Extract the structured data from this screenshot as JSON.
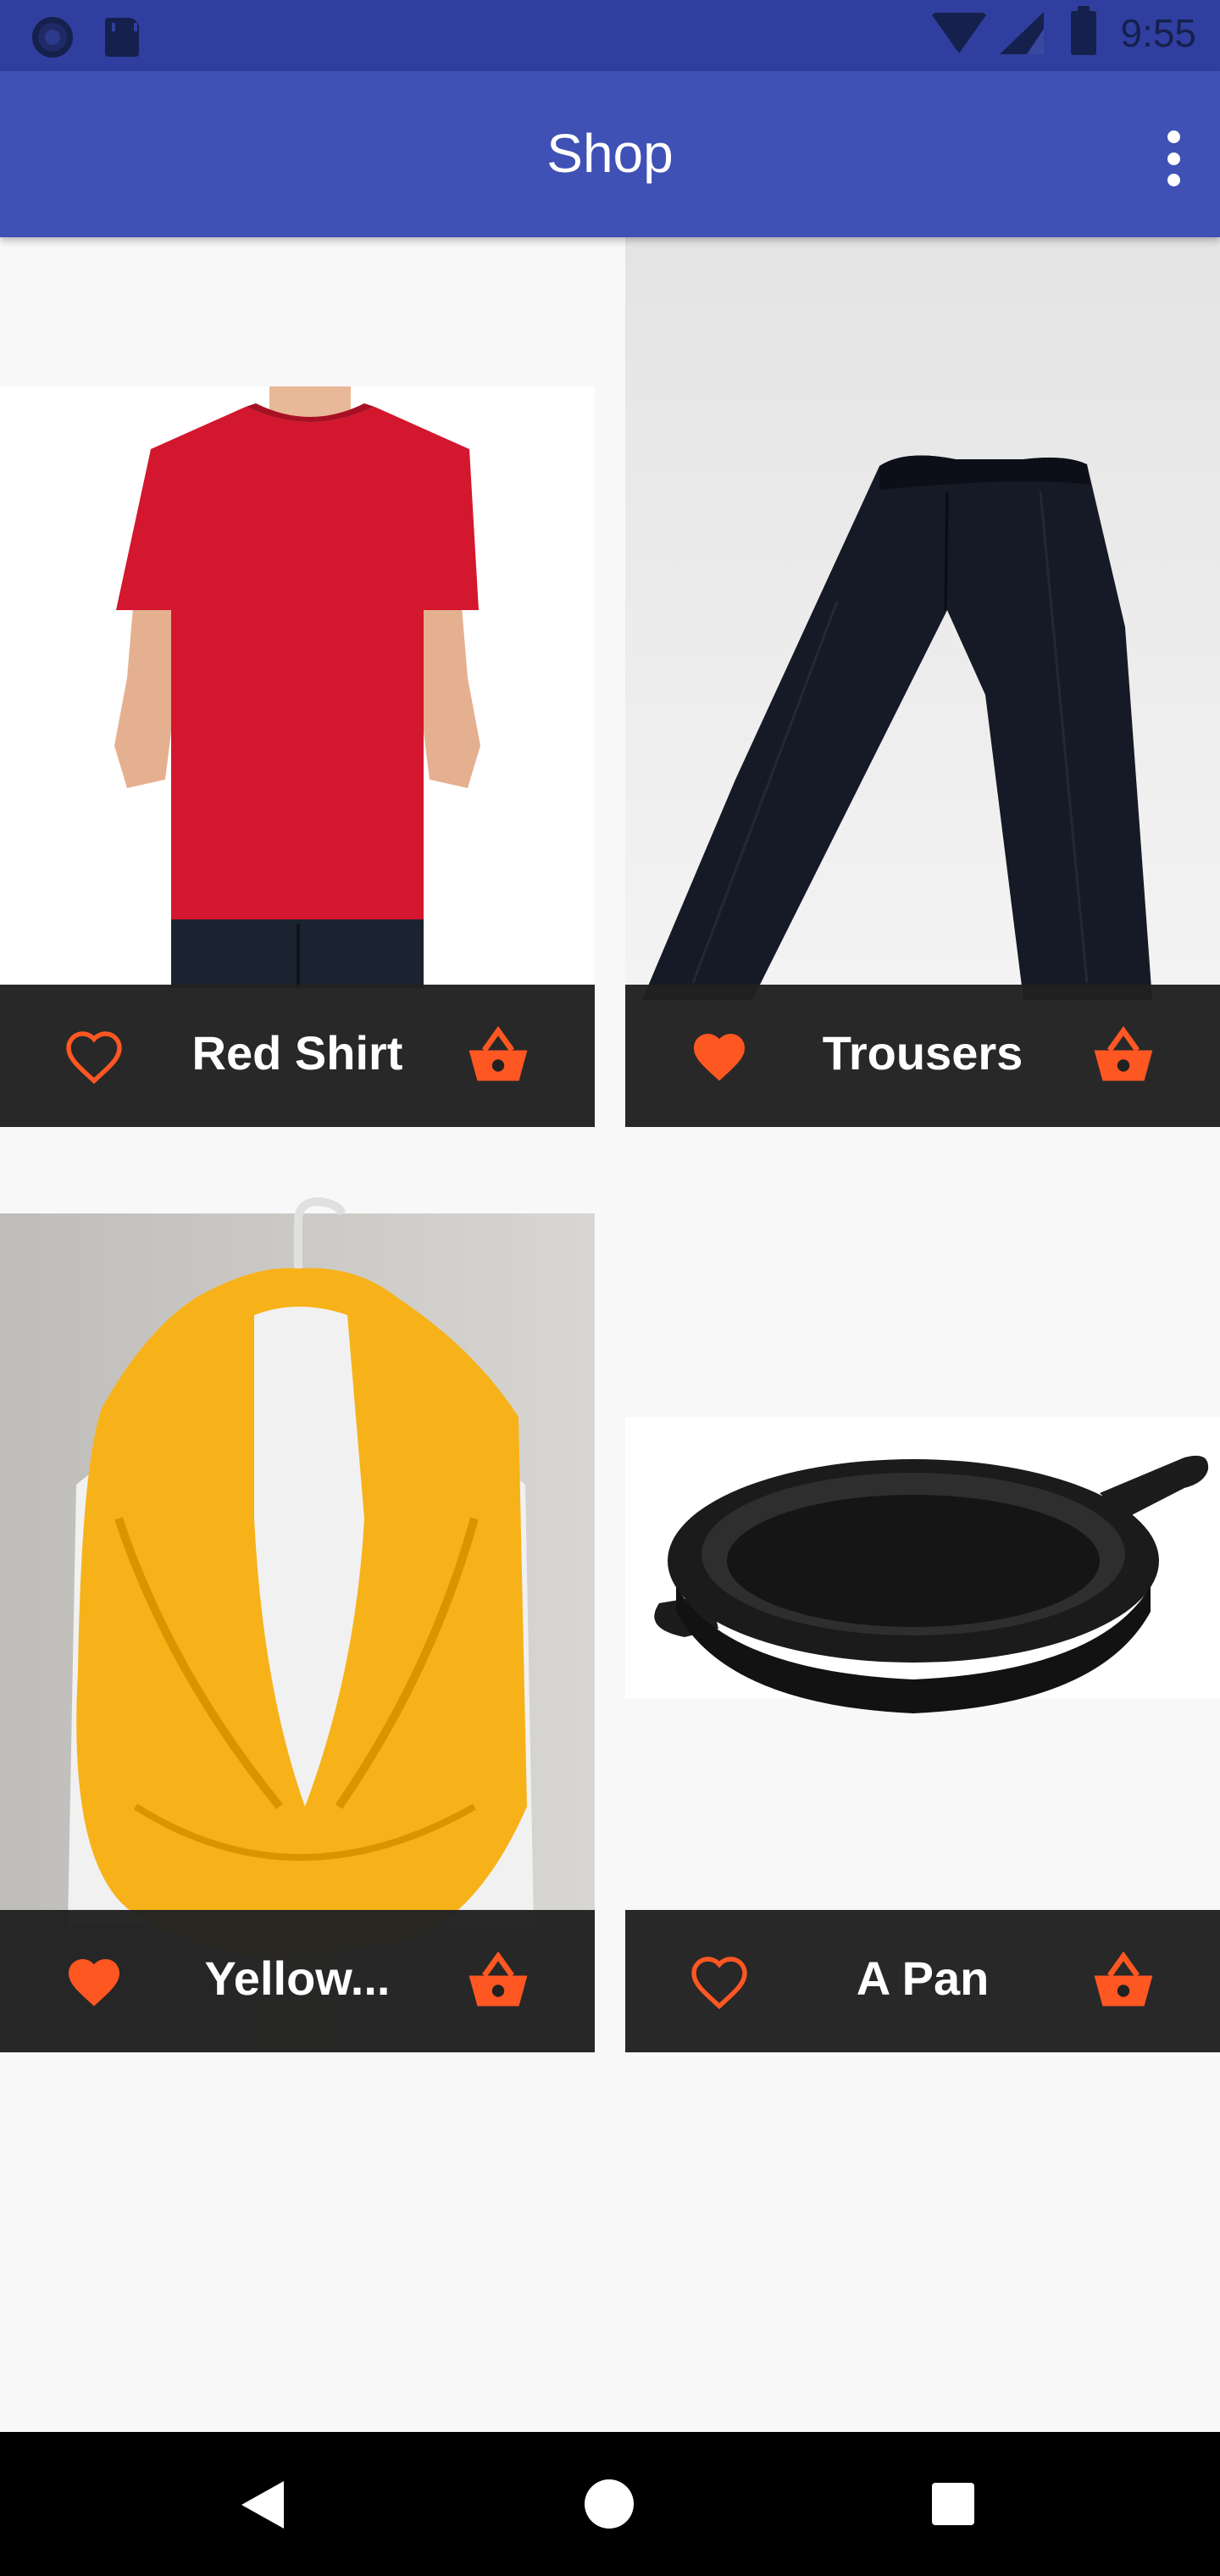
{
  "status_bar": {
    "time": "9:55",
    "icons": [
      "circle-app-icon",
      "sd-card-icon",
      "wifi-icon",
      "signal-icon",
      "battery-icon"
    ]
  },
  "app_bar": {
    "title": "Shop",
    "menu_icon": "overflow-menu-icon"
  },
  "products": [
    {
      "title": "Red Shirt",
      "favorited": false,
      "image": "red t-shirt on model",
      "fav_icon": "heart-outline-icon",
      "cart_icon": "shopping-basket-icon"
    },
    {
      "title": "Trousers",
      "favorited": true,
      "image": "black trousers",
      "fav_icon": "heart-filled-icon",
      "cart_icon": "shopping-basket-icon"
    },
    {
      "title": "Yellow...",
      "favorited": true,
      "image": "yellow knitted scarf on mannequin",
      "fav_icon": "heart-filled-icon",
      "cart_icon": "shopping-basket-icon"
    },
    {
      "title": "A Pan",
      "favorited": false,
      "image": "cast iron skillet",
      "fav_icon": "heart-outline-icon",
      "cart_icon": "shopping-basket-icon"
    }
  ],
  "colors": {
    "primary": "#3f51b5",
    "primary_dark": "#303f9f",
    "accent": "#ff5722",
    "card_footer": "#212121",
    "background": "#f8f8f8"
  },
  "nav_bar": {
    "buttons": [
      "back-icon",
      "home-icon",
      "recents-icon"
    ]
  }
}
